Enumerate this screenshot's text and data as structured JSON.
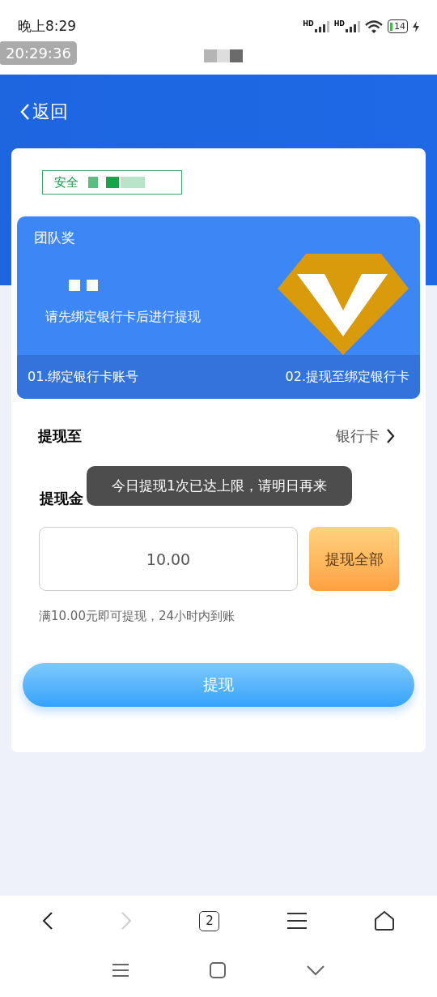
{
  "status_bar": {
    "time": "晚上8:29",
    "signals": [
      {
        "label": "HD"
      },
      {
        "label": "HD"
      }
    ],
    "battery": "14",
    "clock_badge": "20:29:36"
  },
  "header": {
    "back": "返回"
  },
  "badge": "安全",
  "panel": {
    "title": "团队奖",
    "notice": "请先绑定银行卡后进行提现",
    "steps": [
      "01.绑定银行卡账号",
      "02.提现至绑定银行卡"
    ]
  },
  "destination": {
    "label": "提现至",
    "value": "银行卡"
  },
  "amount": {
    "label": "提现金",
    "value": "10.00",
    "all_button": "提现全部",
    "hint": "满10.00元即可提现，24小时内到账"
  },
  "submit": "提现",
  "toast": "今日提现1次已达上限，请明日再来",
  "browser_bar": {
    "tabs_count": "2",
    "forward_disabled": true
  }
}
